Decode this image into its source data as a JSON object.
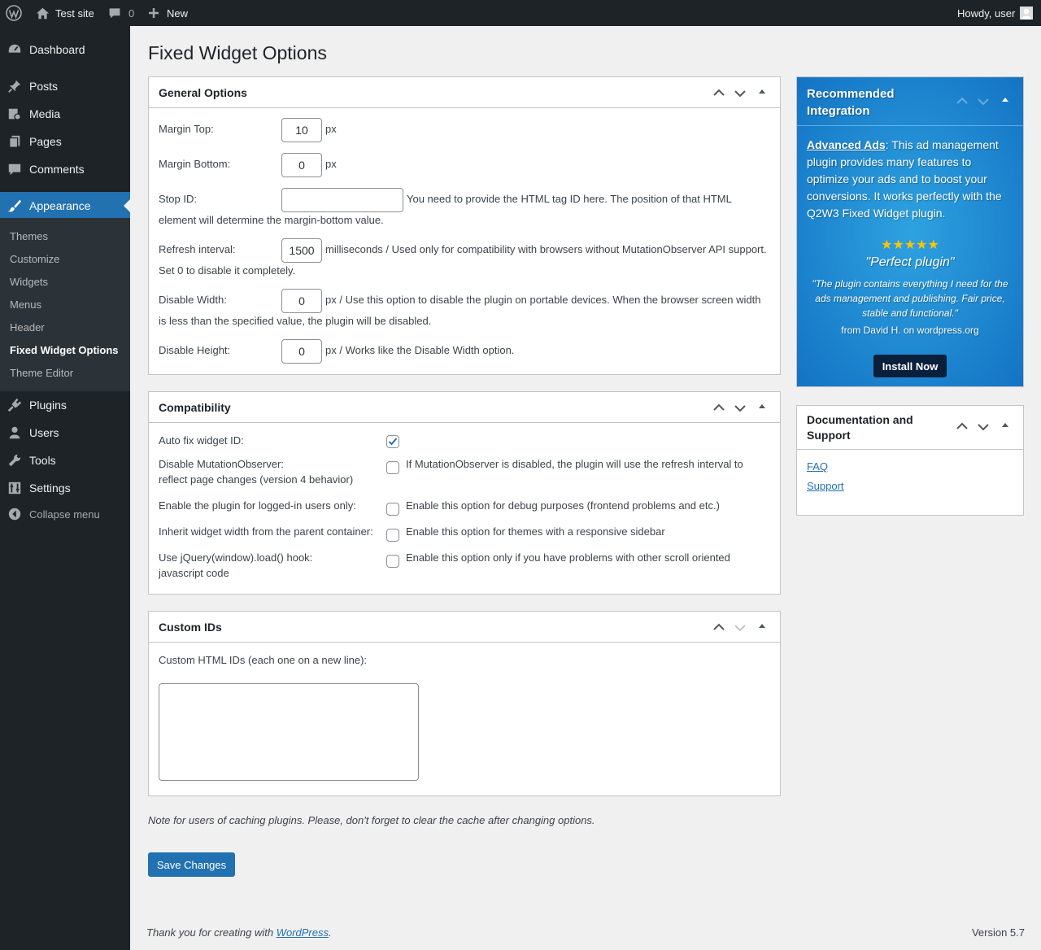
{
  "adminbar": {
    "site_name": "Test site",
    "comments_count": "0",
    "new_label": "New",
    "howdy": "Howdy, user"
  },
  "menu": {
    "dashboard": "Dashboard",
    "posts": "Posts",
    "media": "Media",
    "pages": "Pages",
    "comments": "Comments",
    "appearance": "Appearance",
    "plugins": "Plugins",
    "users": "Users",
    "tools": "Tools",
    "settings": "Settings",
    "collapse": "Collapse menu"
  },
  "submenu": [
    "Themes",
    "Customize",
    "Widgets",
    "Menus",
    "Header",
    "Fixed Widget Options",
    "Theme Editor"
  ],
  "page_title": "Fixed Widget Options",
  "general": {
    "title": "General Options",
    "margin_top_label": "Margin Top:",
    "margin_top_value": "10",
    "px": "px",
    "margin_bottom_label": "Margin Bottom:",
    "margin_bottom_value": "0",
    "stop_id_label": "Stop ID:",
    "stop_id_value": "",
    "stop_id_help_1": "You need to provide the HTML tag ID here. The position of that HTML",
    "stop_id_help_2": "element will determine the margin-bottom value.",
    "refresh_label": "Refresh interval:",
    "refresh_value": "1500",
    "refresh_help_1": "milliseconds / Used only for compatibility with browsers without MutationObserver API support.",
    "refresh_help_2": "Set 0 to disable it completely.",
    "disable_width_label": "Disable Width:",
    "disable_width_value": "0",
    "disable_width_help_1": "px / Use this option to disable the plugin on portable devices. When the browser screen width",
    "disable_width_help_2": "is less than the specified value, the plugin will be disabled.",
    "disable_height_label": "Disable Height:",
    "disable_height_value": "0",
    "disable_height_help": "px / Works like the Disable Width option."
  },
  "compat": {
    "title": "Compatibility",
    "auto_fix_label": "Auto fix widget ID:",
    "mo_label_1": "Disable MutationObserver:",
    "mo_label_2": "reflect page changes (version 4 behavior)",
    "mo_help": "If MutationObserver is disabled, the plugin will use the refresh interval to",
    "logged_label": "Enable the plugin for logged-in users only:",
    "logged_help": "Enable this option for debug purposes (frontend problems and etc.)",
    "inherit_label": "Inherit widget width from the parent container:",
    "inherit_help": "Enable this option for themes with a responsive sidebar",
    "jquery_label_1": "Use jQuery(window).load() hook:",
    "jquery_label_2": "javascript code",
    "jquery_help": "Enable this option only if you have problems with other scroll oriented"
  },
  "custom": {
    "title": "Custom IDs",
    "label": "Custom HTML IDs (each one on a new line):",
    "value": ""
  },
  "note": "Note for users of caching plugins. Please, don't forget to clear the cache after changing options.",
  "save_label": "Save Changes",
  "recommended": {
    "title": "Recommended Integration",
    "link": "Advanced Ads",
    "desc": ": This ad management plugin provides many features to optimize your ads and to boost your conversions. It works perfectly with the Q2W3 Fixed Widget plugin.",
    "stars": "★★★★★",
    "quote_title": "\"Perfect plugin\"",
    "quote": "\"The plugin contains everything I need for the ads management and publishing. Fair price, stable and functional.\"",
    "from": "from David H. on wordpress.org",
    "install": "Install Now"
  },
  "docs": {
    "title": "Documentation and Support",
    "faq": "FAQ",
    "support": "Support"
  },
  "footer": {
    "thanks_prefix": "Thank you for creating with ",
    "wp_link": "WordPress",
    "thanks_suffix": ".",
    "version": "Version 5.7"
  }
}
